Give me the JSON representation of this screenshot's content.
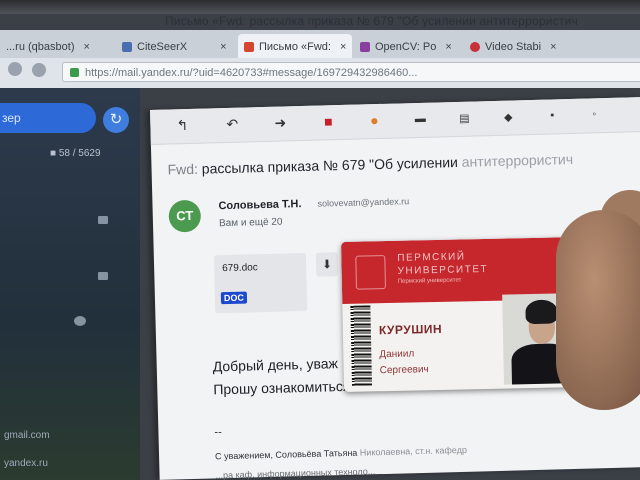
{
  "window": {
    "title": "Письмо «Fwd: рассылка приказа № 679 \"Об усилении антитеррористич"
  },
  "tabs": [
    {
      "label": "...ru (qbasbot)",
      "close": "×"
    },
    {
      "label": "CiteSeerX",
      "close": "×"
    },
    {
      "label": "Письмо «Fwd:",
      "close": "×"
    },
    {
      "label": "OpenCV: Po",
      "close": "×"
    },
    {
      "label": "Video Stabi",
      "close": "×"
    }
  ],
  "address_bar": {
    "url": "https://mail.yandex.ru/?uid=4620733#message/169729432986460..."
  },
  "sidebar": {
    "compose_label": "зер",
    "refresh_glyph": "↻",
    "counter": "■ 58 / 5629",
    "footer_1": "gmail.com",
    "footer_2": "yandex.ru"
  },
  "mail": {
    "toolbar_icons": [
      "reply-icon",
      "reply-all-icon",
      "forward-icon",
      "delete-icon",
      "spam-icon",
      "archive-icon",
      "move-icon",
      "pin-icon",
      "more-icon"
    ],
    "subject_prefix": "Fwd:",
    "subject": "рассылка приказа № 679 \"Об усилении",
    "subject_faded": " антитеррористич",
    "avatar_initials": "СТ",
    "sender_name": "Соловьева Т.Н.",
    "sender_email": "solovevatn@yandex.ru",
    "recipients": "Вам и ещё 20",
    "attachment_name": "679.doc",
    "attachment_type": "DOC",
    "download_glyph": "⬇",
    "greeting": "Добрый день, уваж",
    "request": "Прошу ознакомиться",
    "separator": "--",
    "signature": "С уважением, Соловьёва Татьяна",
    "signature_faded": " Николаевна, ст.н. кафедр",
    "signature_2": "...ра каф. информационных техноло..."
  },
  "id_card": {
    "university_line_1": "ПЕРМСКИЙ",
    "university_line_2": "УНИВЕРСИТЕТ",
    "university_line_3": "Пермский университет",
    "surname": "КУРУШИН",
    "given_name": "Даниил",
    "patronymic": "Сергеевич",
    "barcode_number": "0003042"
  }
}
